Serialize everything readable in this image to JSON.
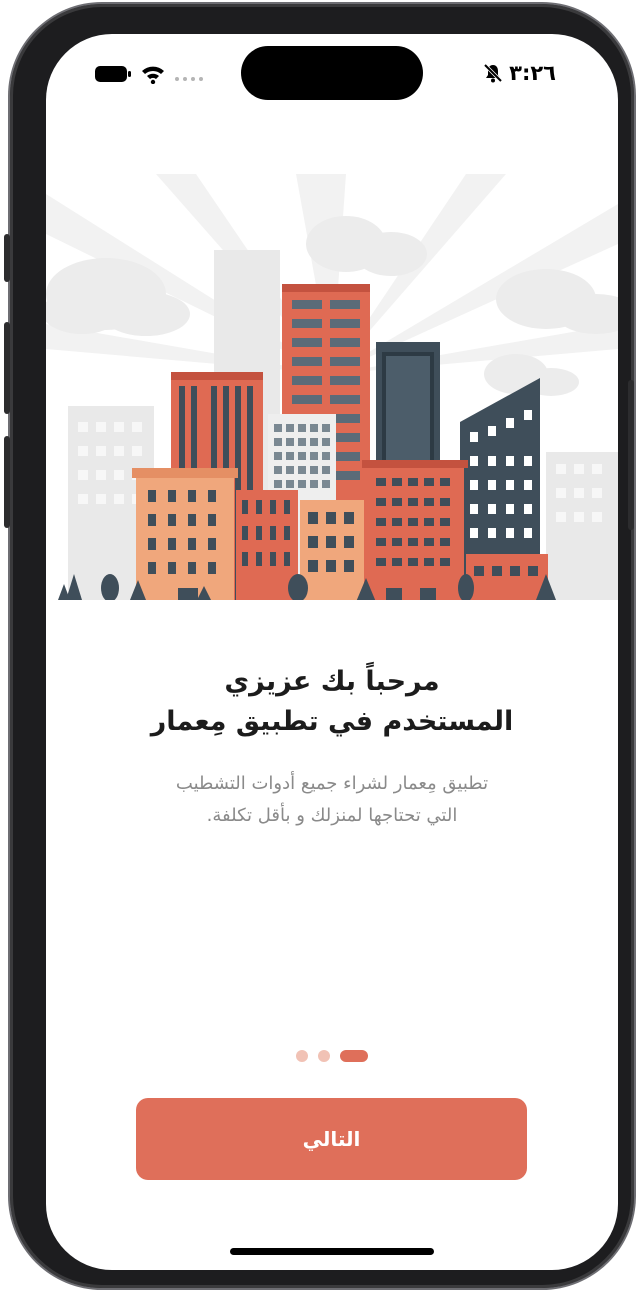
{
  "status_bar": {
    "time": "٣:٢٦",
    "icons": [
      "battery-icon",
      "wifi-icon",
      "signal-icon",
      "bell-slash-icon"
    ]
  },
  "onboarding": {
    "title_line1": "مرحباً بك عزيزي",
    "title_line2": "المستخدم في تطبيق مِعمار",
    "subtitle_line1": "تطبيق مِعمار لشراء جميع أدوات التشطيب",
    "subtitle_line2": "التي تحتاجها لمنزلك و بأقل تكلفة.",
    "page_count": 3,
    "current_page": 3,
    "next_button": "التالي"
  },
  "colors": {
    "accent": "#df6f5a",
    "dot_inactive": "#f1c2b5",
    "building_orange": "#df6a53",
    "building_peach": "#f0a77c",
    "building_dark": "#3f4e5a",
    "background_gray": "#ededed"
  }
}
